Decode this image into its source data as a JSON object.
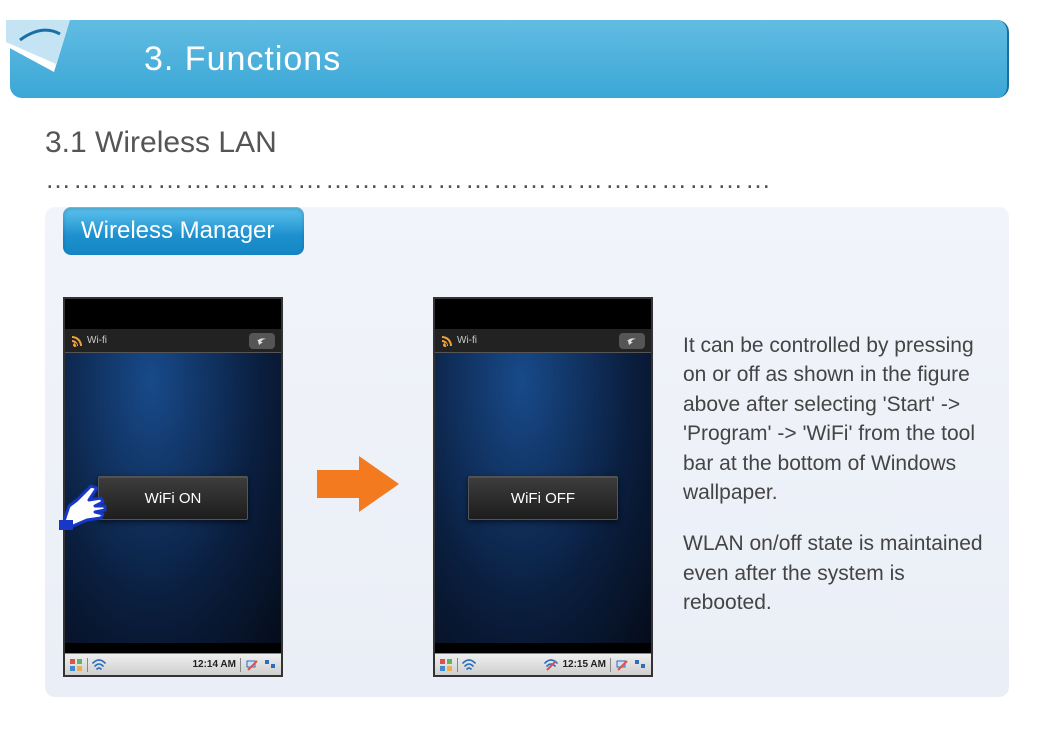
{
  "header": {
    "title": "3. Functions"
  },
  "section": {
    "heading": "3.1 Wireless LAN"
  },
  "tab": {
    "label": "Wireless Manager"
  },
  "phone1": {
    "titlebar": "Wi-fi",
    "button": "WiFi ON",
    "clock": "12:14 AM"
  },
  "phone2": {
    "titlebar": "Wi-fi",
    "button": "WiFi OFF",
    "clock": "12:15 AM"
  },
  "description": {
    "p1": "It can be controlled by pressing on or off as shown in the figure above after selecting 'Start' -> 'Program' -> 'WiFi' from the tool bar at the bottom of Windows wallpaper.",
    "p2": "WLAN on/off state is maintained even after the system is rebooted."
  },
  "colors": {
    "arrow": "#f47a1f",
    "banner_top": "#62bce2",
    "banner_bottom": "#3aa7d6"
  }
}
